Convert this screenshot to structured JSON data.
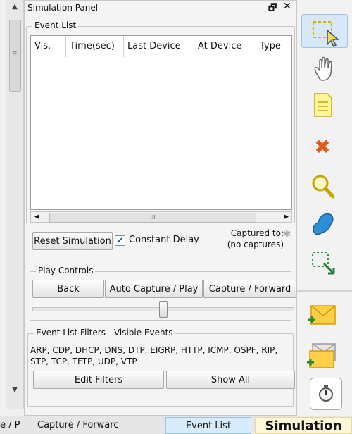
{
  "panel": {
    "title": "Simulation Panel",
    "restore_icon": "restore-window-icon",
    "close_icon": "close-icon"
  },
  "event_list": {
    "group_title": "Event List",
    "columns": [
      "Vis.",
      "Time(sec)",
      "Last Device",
      "At Device",
      "Type"
    ],
    "rows": []
  },
  "controls": {
    "reset_label": "Reset Simulation",
    "constant_delay_label": "Constant Delay",
    "constant_delay_checked": true,
    "captured_to_label": "Captured to:",
    "captured_value": "(no captures)"
  },
  "play_controls": {
    "group_title": "Play Controls",
    "back_label": "Back",
    "auto_label": "Auto Capture / Play",
    "forward_label": "Capture / Forward"
  },
  "filters": {
    "group_title": "Event List Filters - Visible Events",
    "visible_events": "ARP, CDP, DHCP, DNS, DTP, EIGRP, HTTP, ICMP, OSPF, RIP, STP, TCP, TFTP, UDP, VTP",
    "edit_label": "Edit Filters",
    "show_all_label": "Show All"
  },
  "toolbar": {
    "tools": [
      "select-icon",
      "hand-move-icon",
      "note-icon",
      "delete-icon",
      "inspect-icon",
      "draw-shape-icon",
      "resize-icon",
      "add-simple-pdu-icon",
      "add-complex-pdu-icon"
    ]
  },
  "tabs": {
    "realtime_label": "e / P",
    "capture_label": "Capture / Forwarc",
    "event_list_label": "Event List",
    "simulation_label": "Simulation"
  },
  "colors": {
    "active_tool_bg": "#d6e8fa",
    "event_tab_bg": "#d8ecff",
    "simulation_tab_bg": "#fff8d8"
  }
}
